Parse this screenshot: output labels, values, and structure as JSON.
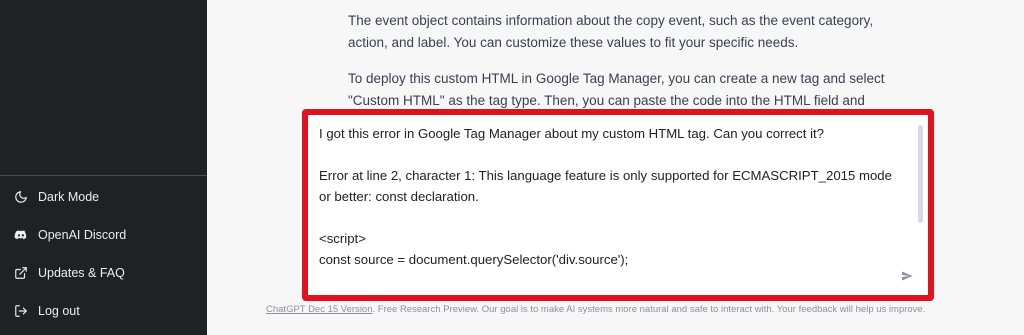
{
  "sidebar": {
    "items": [
      {
        "label": "Dark Mode",
        "icon": "moon-icon"
      },
      {
        "label": "OpenAI Discord",
        "icon": "discord-icon"
      },
      {
        "label": "Updates & FAQ",
        "icon": "external-link-icon"
      },
      {
        "label": "Log out",
        "icon": "logout-icon"
      }
    ]
  },
  "response": {
    "paragraph1": "The event object contains information about the copy event, such as the event category, action, and label. You can customize these values to fit your specific needs.",
    "paragraph2": "To deploy this custom HTML in Google Tag Manager, you can create a new tag and select \"Custom HTML\" as the tag type. Then, you can paste the code into the HTML field and"
  },
  "prompt": {
    "value": "I got this error in Google Tag Manager about my custom HTML tag. Can you correct it?\n\nError at line 2, character 1: This language feature is only supported for ECMASCRIPT_2015 mode\nor better: const declaration.\n\n<script>\nconst source = document.querySelector('div.source');\n\nsource.addEventListener('copy', (event) => {"
  },
  "footer": {
    "link": "ChatGPT Dec 15 Version",
    "text": ". Free Research Preview. Our goal is to make AI systems more natural and safe to interact with. Your feedback will help us improve."
  },
  "colors": {
    "highlight_border": "#e0121d",
    "sidebar_bg": "#202123"
  }
}
